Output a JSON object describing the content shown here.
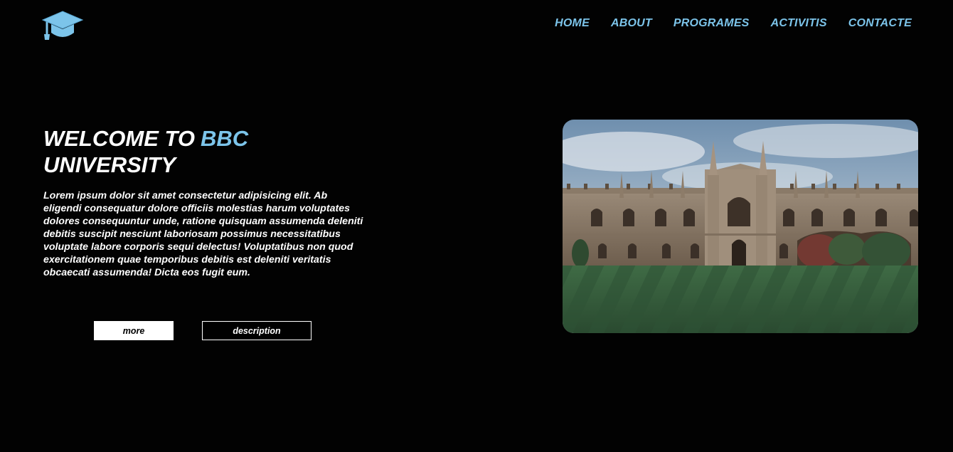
{
  "brand": {
    "logo_icon": "graduation-cap-icon",
    "accent_color": "#7cc4ea"
  },
  "nav": {
    "items": [
      {
        "label": "HOME"
      },
      {
        "label": "ABOUT"
      },
      {
        "label": "PROGRAMES"
      },
      {
        "label": "ACTIVITIS"
      },
      {
        "label": "CONTACTE"
      }
    ]
  },
  "hero": {
    "title_prefix": "WELCOME TO",
    "title_accent": "BBC",
    "title_suffix": "UNIVERSITY",
    "paragraph": "Lorem ipsum dolor sit amet consectetur adipisicing elit. Ab eligendi consequatur dolore officiis molestias harum voluptates dolores consequuntur unde, ratione quisquam assumenda deleniti debitis suscipit nesciunt laboriosam possimus necessitatibus voluptate labore corporis sequi delectus! Voluptatibus non quod exercitationem quae temporibus debitis est deleniti veritatis obcaecati assumenda! Dicta eos fugit eum.",
    "more_label": "more",
    "description_label": "description",
    "image_subject": "university-building-photo"
  }
}
